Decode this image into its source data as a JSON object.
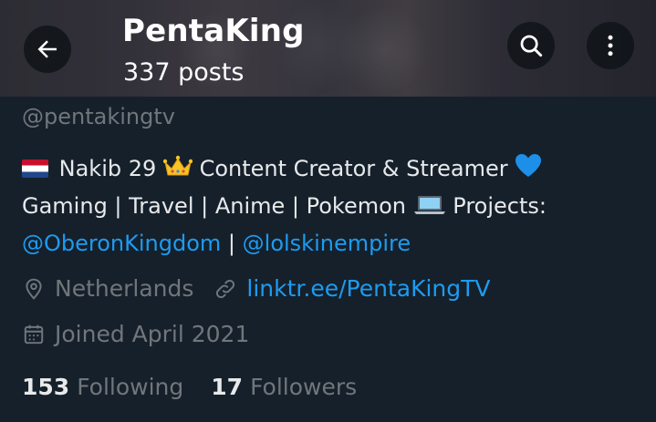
{
  "header": {
    "title": "PentaKing",
    "posts": "337 posts"
  },
  "profile": {
    "handle": "@pentakingtv",
    "bio_line1": "Nakib 29",
    "bio_line1b": "Content Creator & Streamer",
    "bio_line2": "Gaming | Travel | Anime | Pokemon",
    "bio_line2b": "Projects:",
    "bio_link1": "@OberonKingdom",
    "bio_sep": "|",
    "bio_link2": "@lolskinempire",
    "location": "Netherlands",
    "website": "linktr.ee/PentaKingTV",
    "joined": "Joined April 2021",
    "following_count": "153",
    "following_label": "Following",
    "followers_count": "17",
    "followers_label": "Followers"
  },
  "icons": {
    "back": "arrow-left-icon",
    "search": "search-icon",
    "more": "more-vertical-icon",
    "location": "location-pin-icon",
    "link": "link-icon",
    "calendar": "calendar-icon",
    "flag": "netherlands-flag-emoji",
    "crown": "crown-emoji",
    "heart": "blue-heart-emoji",
    "laptop": "laptop-emoji"
  },
  "colors": {
    "background": "#15202b",
    "link": "#1d9bf0",
    "muted": "#71767b",
    "text": "#e7e9ea"
  }
}
